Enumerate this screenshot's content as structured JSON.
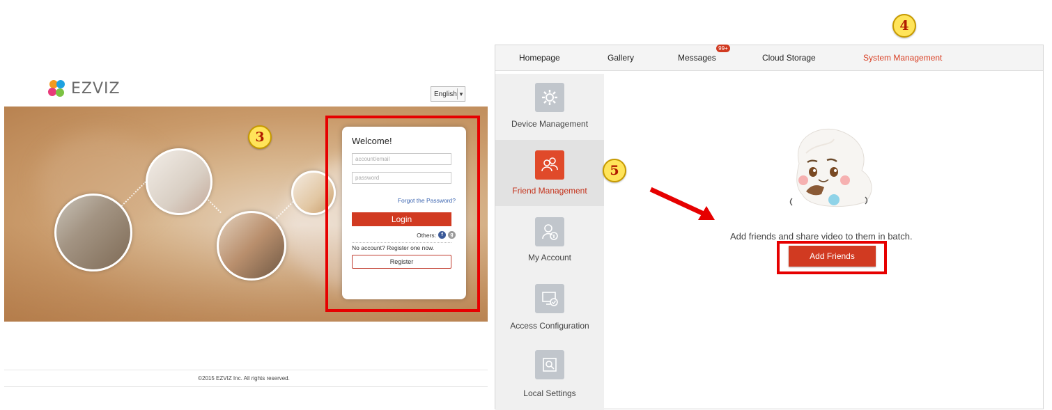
{
  "login_page": {
    "logo_text": "EZVIZ",
    "language": "English",
    "welcome": "Welcome!",
    "account_placeholder": "account/email",
    "password_placeholder": "password",
    "forgot_password": "Forgot the Password?",
    "login_button": "Login",
    "others_label": "Others:",
    "no_account_text": "No account? Register one now.",
    "register_button": "Register",
    "copyright": "©2015  EZVIZ Inc. All rights reserved."
  },
  "app": {
    "nav": [
      {
        "label": "Homepage"
      },
      {
        "label": "Gallery"
      },
      {
        "label": "Messages",
        "badge": "99+"
      },
      {
        "label": "Cloud Storage"
      },
      {
        "label": "System Management",
        "active": true
      }
    ],
    "sidebar": [
      {
        "label": "Device Management",
        "icon": "gear-icon"
      },
      {
        "label": "Friend Management",
        "icon": "friends-icon",
        "active": true
      },
      {
        "label": "My Account",
        "icon": "account-icon"
      },
      {
        "label": "Access Configuration",
        "icon": "access-config-icon"
      },
      {
        "label": "Local Settings",
        "icon": "local-settings-icon"
      }
    ],
    "empty_message": "Add friends and share video to them in batch.",
    "add_friends_button": "Add Friends"
  },
  "annotations": {
    "step3": "3",
    "step4": "4",
    "step5": "5",
    "highlight_color": "#e60000",
    "badge_color": "#ffe45a"
  },
  "colors": {
    "accent": "#d13a21",
    "active_nav": "#d94126"
  }
}
